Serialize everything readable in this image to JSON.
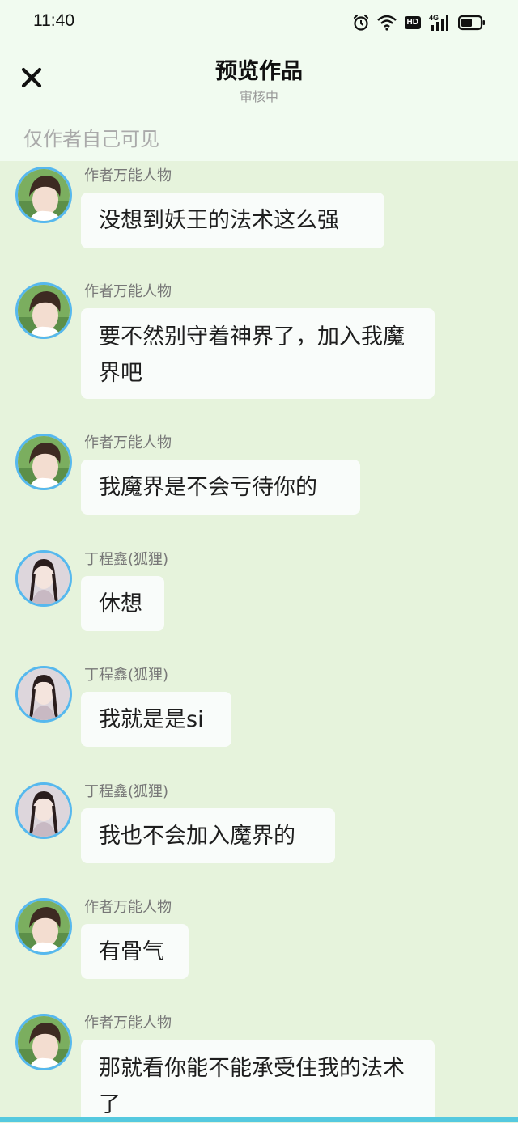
{
  "status_bar": {
    "time": "11:40",
    "icons": [
      "alarm-icon",
      "wifi-icon",
      "hd-badge",
      "signal-4g-icon",
      "battery-icon"
    ],
    "hd_label": "HD",
    "network_label": "4G"
  },
  "header": {
    "close_icon": "close-icon",
    "title": "预览作品",
    "subtitle": "审核中",
    "visibility_note": "仅作者自己可见"
  },
  "messages": [
    {
      "sender": "作者万能人物",
      "avatar": "author-avatar",
      "text": "没想到妖王的法术这么强"
    },
    {
      "sender": "作者万能人物",
      "avatar": "author-avatar",
      "text": "要不然别守着神界了，加入我魔界吧"
    },
    {
      "sender": "作者万能人物",
      "avatar": "author-avatar",
      "text": "我魔界是不会亏待你的"
    },
    {
      "sender": "丁程鑫(狐狸)",
      "avatar": "fox-avatar",
      "text": "休想"
    },
    {
      "sender": "丁程鑫(狐狸)",
      "avatar": "fox-avatar",
      "text": "我就是是si"
    },
    {
      "sender": "丁程鑫(狐狸)",
      "avatar": "fox-avatar",
      "text": "我也不会加入魔界的"
    },
    {
      "sender": "作者万能人物",
      "avatar": "author-avatar",
      "text": "有骨气"
    },
    {
      "sender": "作者万能人物",
      "avatar": "author-avatar",
      "text": "那就看你能不能承受住我的法术了"
    }
  ],
  "colors": {
    "header_bg": "#f1fbf0",
    "chat_bg": "#e6f3dc",
    "bubble_bg": "#f9fcfa",
    "avatar_ring": "#56b8ee",
    "bottom_bar": "#55c9df"
  }
}
